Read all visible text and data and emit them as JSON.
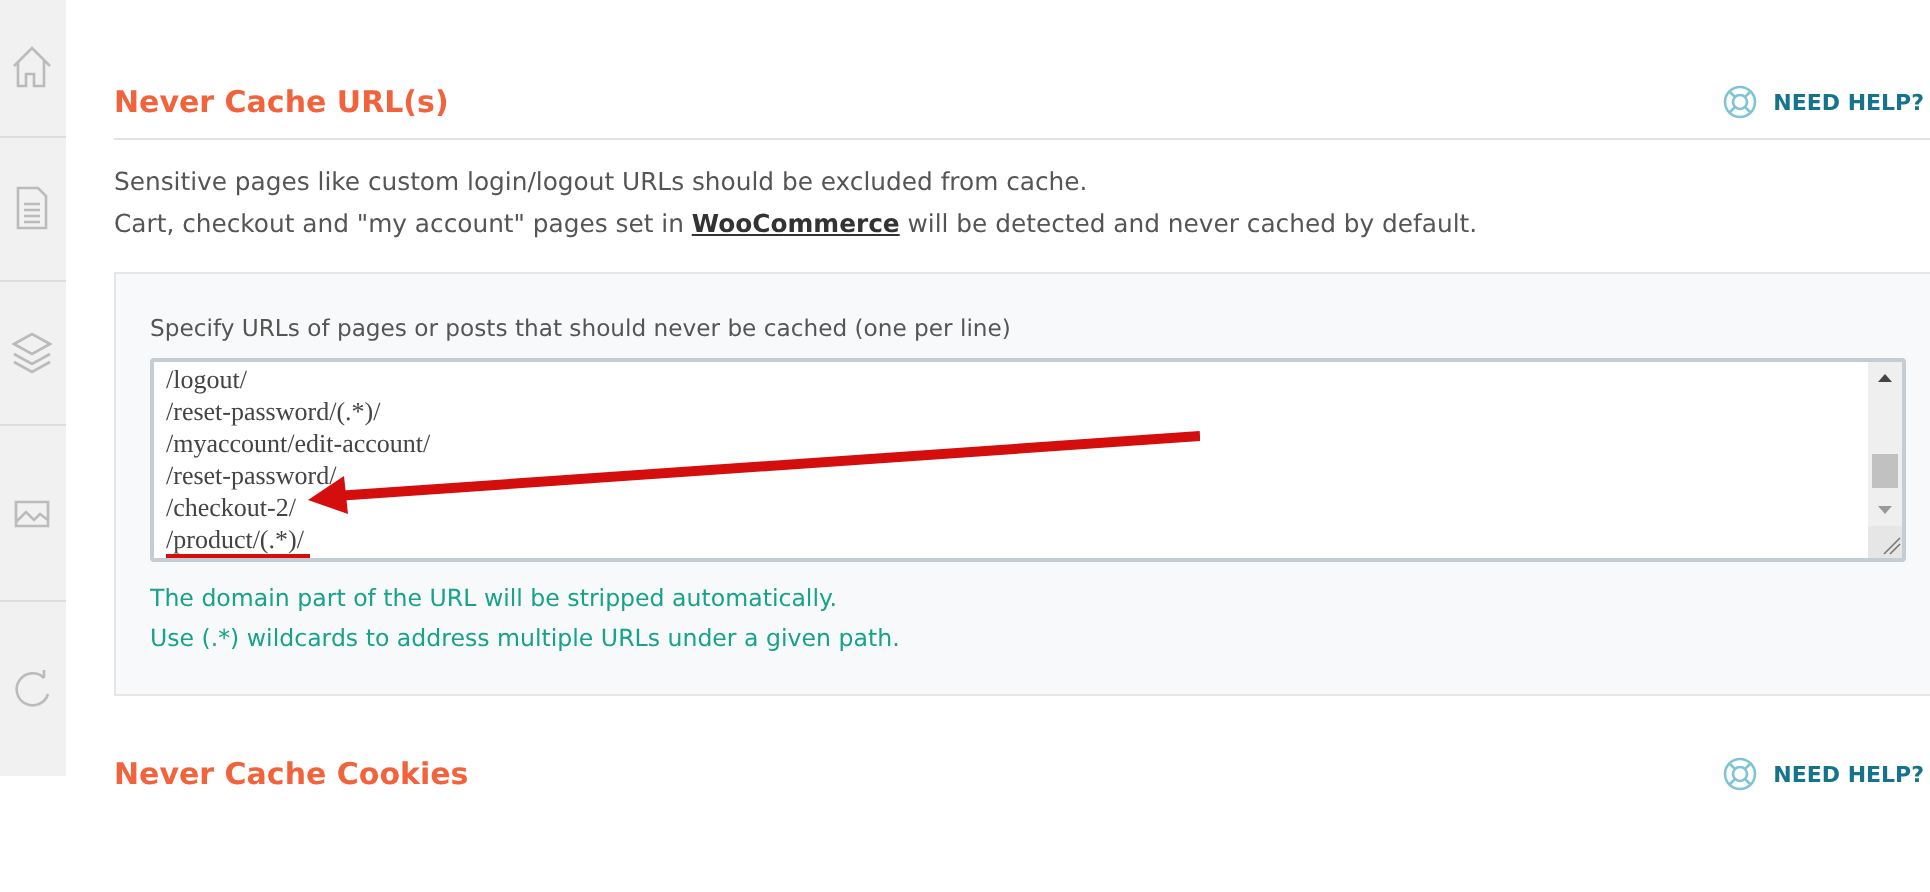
{
  "sections": [
    {
      "title": "Never Cache URL(s)",
      "help": "NEED HELP?",
      "description": [
        "Sensitive pages like custom login/logout URLs should be excluded from cache.",
        "Cart, checkout and \"my account\" pages set in **WooCommerce** will be detected and never cached by default."
      ],
      "field": {
        "label": "Specify URLs of pages or posts that should never be cached (one per line)",
        "value": [
          "/logout/",
          "/reset-password/(.*)/",
          "/myaccount/edit-account/",
          "/reset-password/",
          "/checkout-2/",
          "/product/(.*)/"
        ]
      },
      "hints": [
        "The domain part of the URL will be stripped automatically.",
        "Use (.*) wildcards to address multiple URLs under a given path."
      ]
    },
    {
      "title": "Never Cache Cookies",
      "help": "NEED HELP?"
    }
  ]
}
